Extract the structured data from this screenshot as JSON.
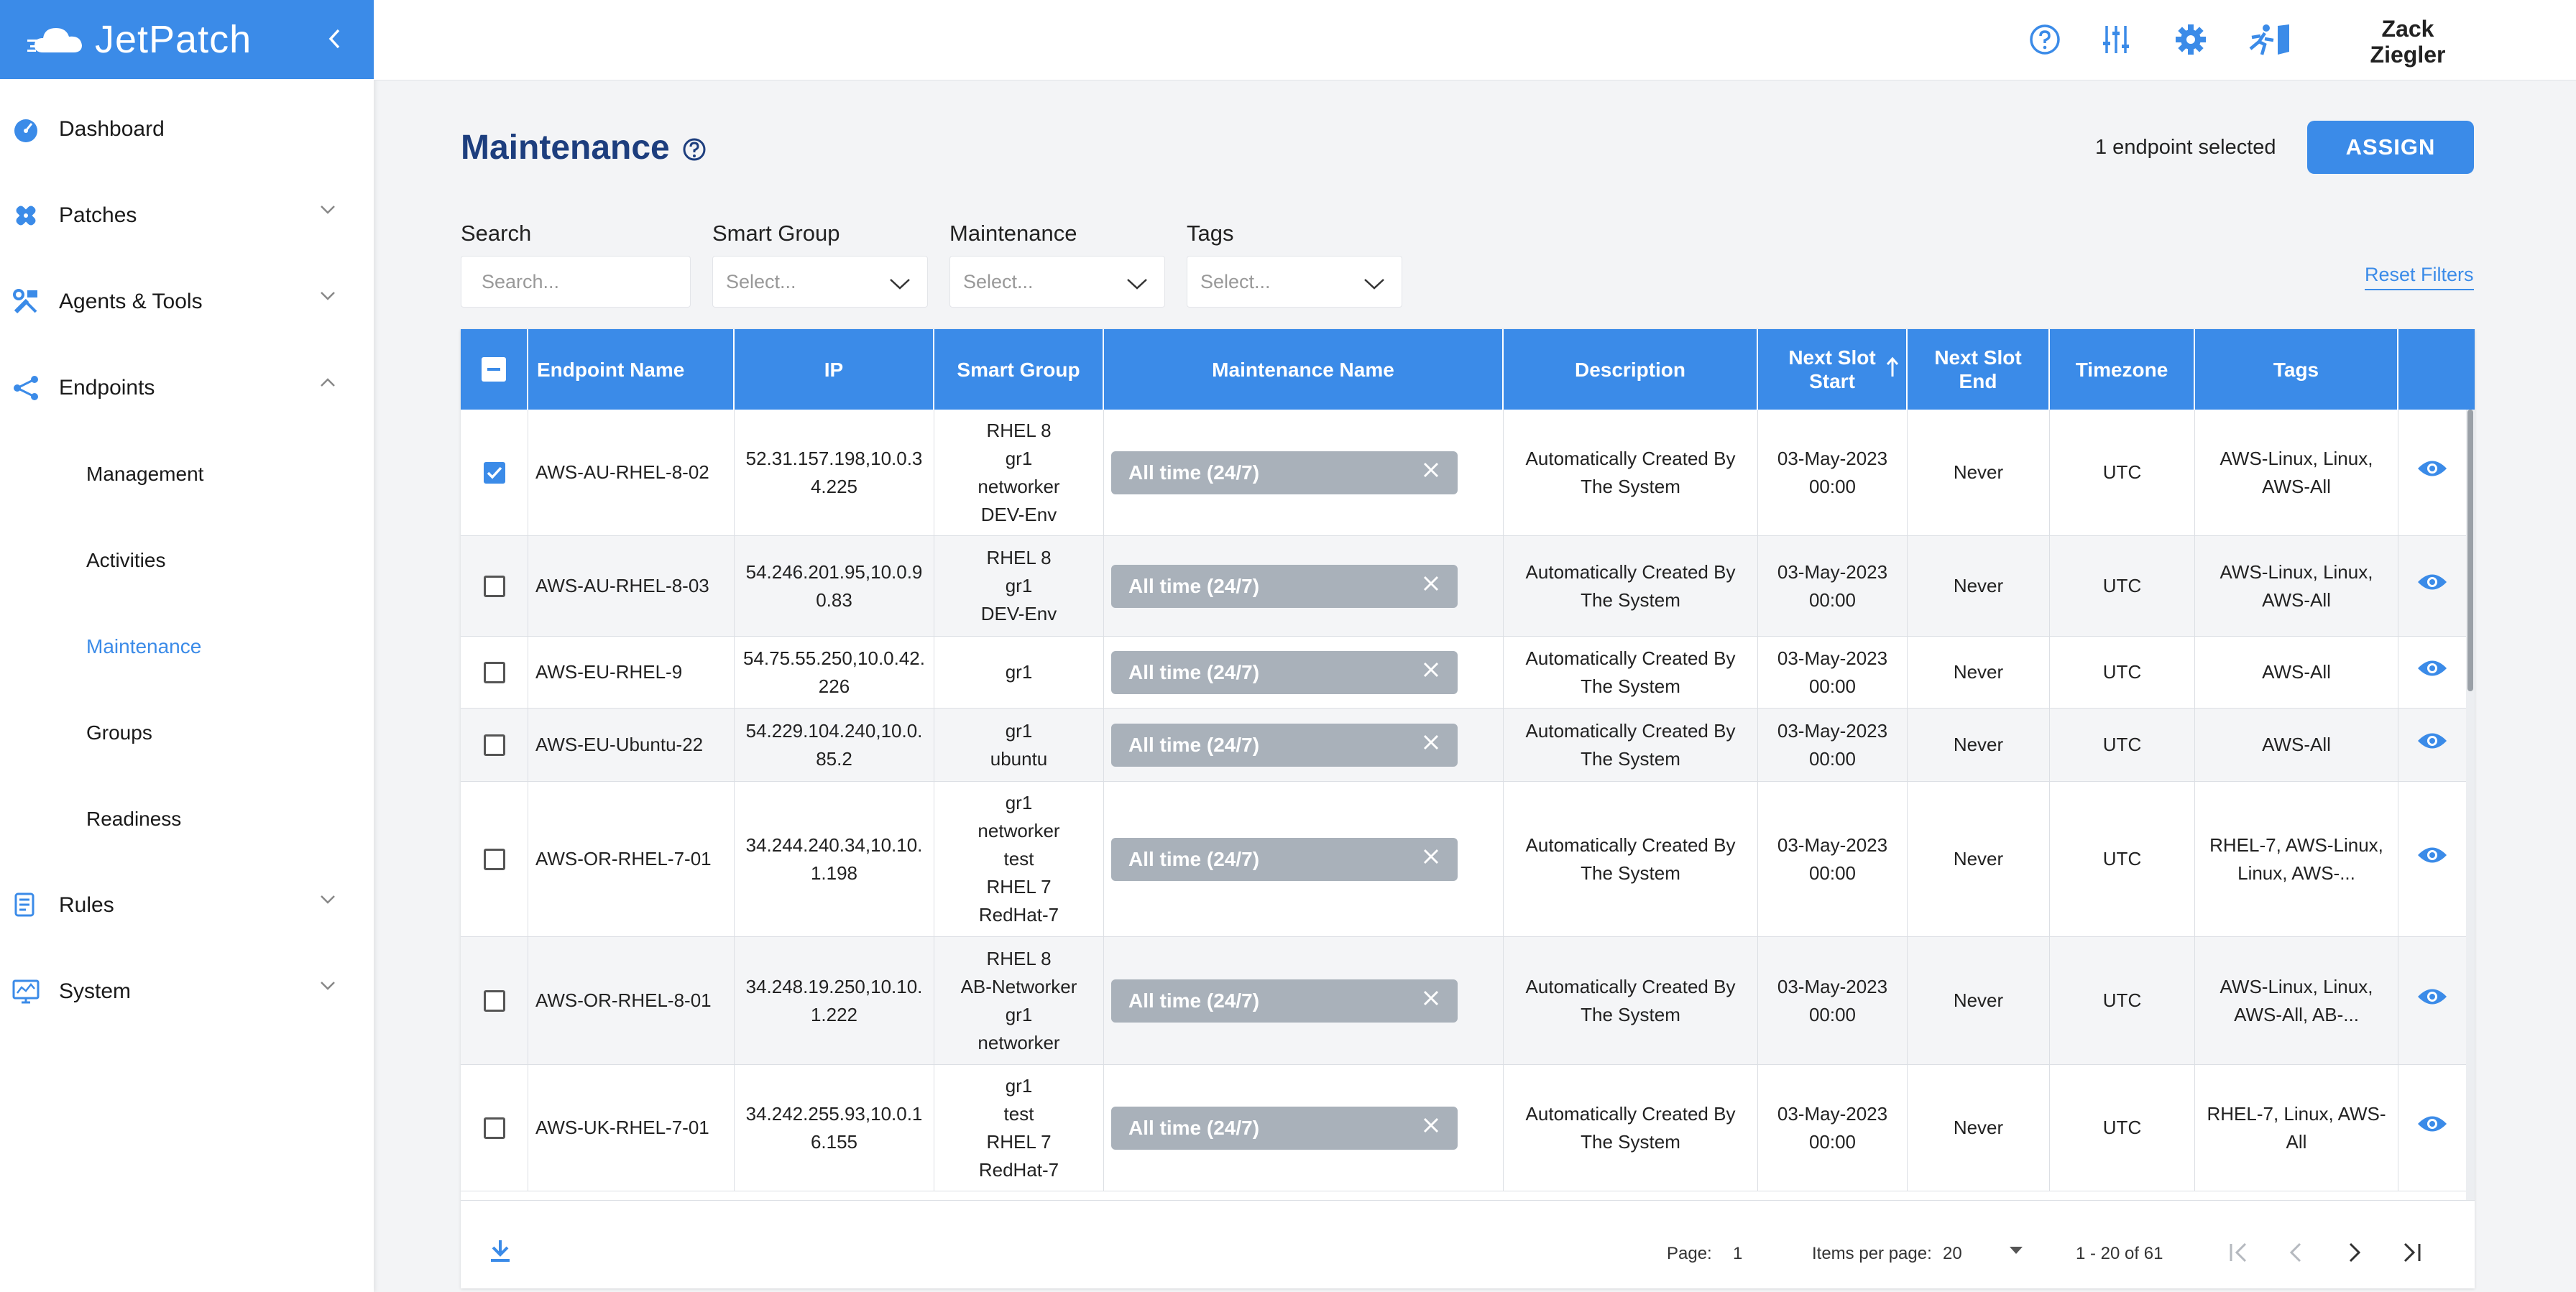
{
  "brand": {
    "name": "JetPatch"
  },
  "sidebar": {
    "items": [
      {
        "label": "Dashboard"
      },
      {
        "label": "Patches"
      },
      {
        "label": "Agents & Tools"
      },
      {
        "label": "Endpoints"
      },
      {
        "label": "Rules"
      },
      {
        "label": "System"
      }
    ],
    "endpoints_sub": [
      {
        "label": "Management"
      },
      {
        "label": "Activities"
      },
      {
        "label": "Maintenance"
      },
      {
        "label": "Groups"
      },
      {
        "label": "Readiness"
      }
    ]
  },
  "topbar": {
    "user_first": "Zack",
    "user_last": "Ziegler"
  },
  "page": {
    "title": "Maintenance",
    "selected_count": "1 endpoint selected",
    "assign_label": "ASSIGN",
    "reset_filters": "Reset Filters"
  },
  "filters": {
    "search_label": "Search",
    "search_placeholder": "Search...",
    "smart_group_label": "Smart Group",
    "smart_group_placeholder": "Select...",
    "maintenance_label": "Maintenance",
    "maintenance_placeholder": "Select...",
    "tags_label": "Tags",
    "tags_placeholder": "Select..."
  },
  "table": {
    "headers": {
      "endpoint_name": "Endpoint Name",
      "ip": "IP",
      "smart_group": "Smart Group",
      "maintenance_name": "Maintenance Name",
      "description": "Description",
      "next_slot_start_1": "Next Slot",
      "next_slot_start_2": "Start",
      "next_slot_end_1": "Next Slot",
      "next_slot_end_2": "End",
      "timezone": "Timezone",
      "tags": "Tags"
    },
    "rows": [
      {
        "checked": true,
        "name": "AWS-AU-RHEL-8-02",
        "ip": [
          "52.31.157.198,10.0.3",
          "4.225"
        ],
        "groups": [
          "RHEL 8",
          "gr1",
          "networker",
          "DEV-Env"
        ],
        "maintenance": "All time (24/7)",
        "description": [
          "Automatically Created By",
          "The System"
        ],
        "start": [
          "03-May-2023",
          "00:00"
        ],
        "end": "Never",
        "timezone": "UTC",
        "tags": [
          "AWS-Linux, Linux,",
          "AWS-All"
        ]
      },
      {
        "checked": false,
        "name": "AWS-AU-RHEL-8-03",
        "ip": [
          "54.246.201.95,10.0.9",
          "0.83"
        ],
        "groups": [
          "RHEL 8",
          "gr1",
          "DEV-Env"
        ],
        "maintenance": "All time (24/7)",
        "description": [
          "Automatically Created By",
          "The System"
        ],
        "start": [
          "03-May-2023",
          "00:00"
        ],
        "end": "Never",
        "timezone": "UTC",
        "tags": [
          "AWS-Linux, Linux,",
          "AWS-All"
        ]
      },
      {
        "checked": false,
        "name": "AWS-EU-RHEL-9",
        "ip": [
          "54.75.55.250,10.0.42.",
          "226"
        ],
        "groups": [
          "gr1"
        ],
        "maintenance": "All time (24/7)",
        "description": [
          "Automatically Created By",
          "The System"
        ],
        "start": [
          "03-May-2023",
          "00:00"
        ],
        "end": "Never",
        "timezone": "UTC",
        "tags": [
          "AWS-All"
        ]
      },
      {
        "checked": false,
        "name": "AWS-EU-Ubuntu-22",
        "ip": [
          "54.229.104.240,10.0.",
          "85.2"
        ],
        "groups": [
          "gr1",
          "ubuntu"
        ],
        "maintenance": "All time (24/7)",
        "description": [
          "Automatically Created By",
          "The System"
        ],
        "start": [
          "03-May-2023",
          "00:00"
        ],
        "end": "Never",
        "timezone": "UTC",
        "tags": [
          "AWS-All"
        ]
      },
      {
        "checked": false,
        "name": "AWS-OR-RHEL-7-01",
        "ip": [
          "34.244.240.34,10.10.",
          "1.198"
        ],
        "groups": [
          "gr1",
          "networker",
          "test",
          "RHEL 7",
          "RedHat-7"
        ],
        "maintenance": "All time (24/7)",
        "description": [
          "Automatically Created By",
          "The System"
        ],
        "start": [
          "03-May-2023",
          "00:00"
        ],
        "end": "Never",
        "timezone": "UTC",
        "tags": [
          "RHEL-7, AWS-Linux,",
          "Linux, AWS-..."
        ]
      },
      {
        "checked": false,
        "name": "AWS-OR-RHEL-8-01",
        "ip": [
          "34.248.19.250,10.10.",
          "1.222"
        ],
        "groups": [
          "RHEL 8",
          "AB-Networker",
          "gr1",
          "networker"
        ],
        "maintenance": "All time (24/7)",
        "description": [
          "Automatically Created By",
          "The System"
        ],
        "start": [
          "03-May-2023",
          "00:00"
        ],
        "end": "Never",
        "timezone": "UTC",
        "tags": [
          "AWS-Linux, Linux,",
          "AWS-All, AB-..."
        ]
      },
      {
        "checked": false,
        "name": "AWS-UK-RHEL-7-01",
        "ip": [
          "34.242.255.93,10.0.1",
          "6.155"
        ],
        "groups": [
          "gr1",
          "test",
          "RHEL 7",
          "RedHat-7"
        ],
        "maintenance": "All time (24/7)",
        "description": [
          "Automatically Created By",
          "The System"
        ],
        "start": [
          "03-May-2023",
          "00:00"
        ],
        "end": "Never",
        "timezone": "UTC",
        "tags": [
          "RHEL-7, Linux, AWS-",
          "All"
        ]
      }
    ]
  },
  "pagination": {
    "page_label": "Page:",
    "page_value": "1",
    "items_label": "Items per page:",
    "items_value": "20",
    "range": "1 - 20 of 61"
  },
  "colors": {
    "accent": "#3b8be8",
    "title": "#1d3e7e",
    "chip": "#a9b1ba"
  }
}
